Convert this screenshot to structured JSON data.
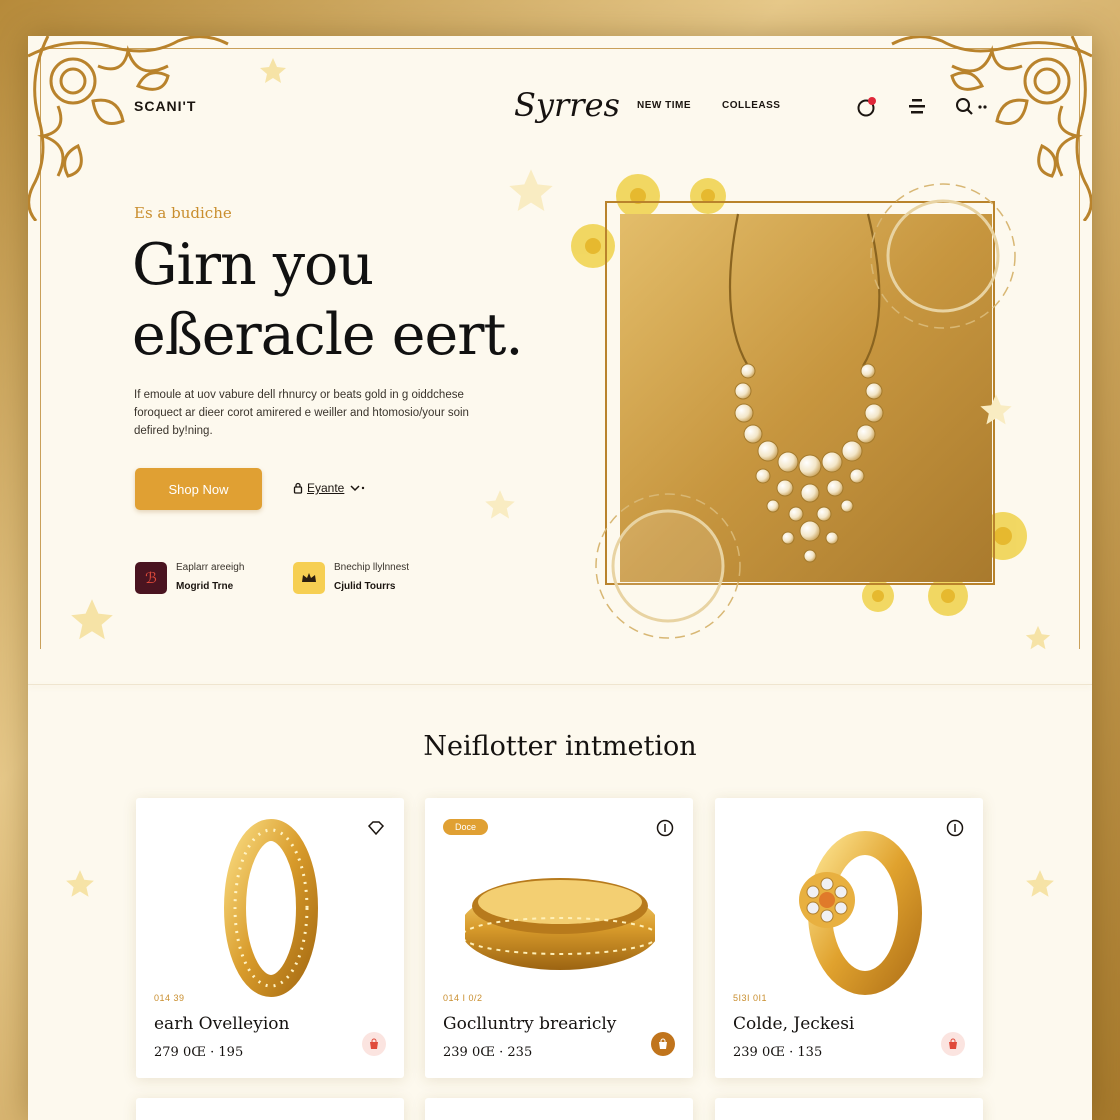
{
  "header": {
    "brand_left": "SCANI'T",
    "logo": "Syrres",
    "nav": [
      "NEW TIME",
      "COLLEASS"
    ],
    "icons": [
      "notification-icon",
      "menu-icon",
      "search-icon",
      "more-icon"
    ]
  },
  "hero": {
    "eyebrow": "Es a budiche",
    "headline_line1": "Girn you",
    "headline_line2": "eßeracle eert.",
    "paragraph": "If emoule at uov vabure dell rhnurcy or beats gold in g oiddchese foroquect ar dieer corot amirered e weiller and htomosio/your soin defired by!ning.",
    "shop_button": "Shop Now",
    "explore_link": "Eyante",
    "features": [
      {
        "line1": "Eaplarr areeigh",
        "line2": "Mogrid Trne",
        "icon": "brand-icon",
        "color": "#4a1420"
      },
      {
        "line1": "Bnechip llylnnest",
        "line2": "Cjulid Tourrs",
        "icon": "crown-icon",
        "color": "#f6cf52"
      }
    ]
  },
  "section": {
    "title": "Neiflotter intmetion"
  },
  "products": [
    {
      "code": "014 39",
      "name": "earh Ovelleyion",
      "price": "279 0Œ · 195",
      "tag": "",
      "corner_icon": "diamond-icon",
      "cart_color": "#fbe4e0",
      "cart_fg": "#e04a3a"
    },
    {
      "code": "014 I 0/2",
      "name": "Goclluntry brearicly",
      "price": "239 0Œ · 235",
      "tag": "Doce",
      "corner_icon": "info-icon",
      "cart_color": "#c0741c",
      "cart_fg": "#ffffff"
    },
    {
      "code": "5I3I 0I1",
      "name": "Colde, Jeckesi",
      "price": "239 0Œ · 135",
      "tag": "",
      "corner_icon": "info-icon",
      "cart_color": "#fbe4e0",
      "cart_fg": "#e04a3a"
    }
  ],
  "colors": {
    "accent": "#e0a033",
    "gold_text": "#c98e2e",
    "page_bg": "#fdf9ee"
  }
}
